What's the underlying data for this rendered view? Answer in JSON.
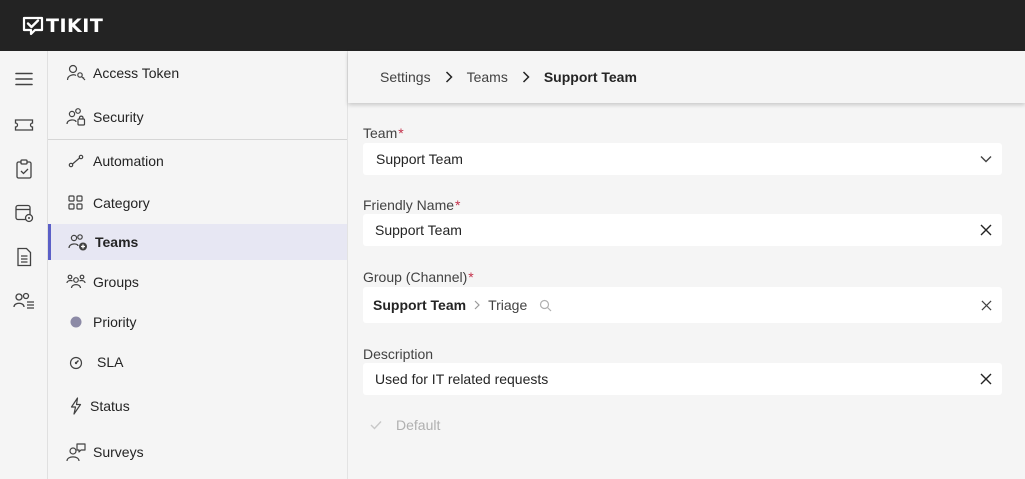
{
  "app": {
    "logo_text": "TIKIT"
  },
  "rail": {
    "items": [
      {
        "icon": "hamburger-menu-icon"
      },
      {
        "icon": "ticket-icon"
      },
      {
        "icon": "clipboard-icon"
      },
      {
        "icon": "calendar-settings-icon"
      },
      {
        "icon": "document-icon"
      },
      {
        "icon": "people-list-icon"
      }
    ]
  },
  "sidebar": {
    "items": [
      {
        "label": "Access Token",
        "icon": "person-key-icon"
      },
      {
        "label": "Security",
        "icon": "people-lock-icon"
      },
      {
        "label": "Automation",
        "icon": "flow-icon"
      },
      {
        "label": "Category",
        "icon": "grid-icon"
      },
      {
        "label": "Teams",
        "icon": "people-add-icon",
        "active": true
      },
      {
        "label": "Groups",
        "icon": "people-community-icon"
      },
      {
        "label": "Priority",
        "icon": "circle-icon"
      },
      {
        "label": "SLA",
        "icon": "gauge-icon"
      },
      {
        "label": "Status",
        "icon": "flash-icon"
      },
      {
        "label": "Surveys",
        "icon": "person-feedback-icon"
      }
    ]
  },
  "breadcrumb": {
    "items": [
      "Settings",
      "Teams",
      "Support Team"
    ]
  },
  "form": {
    "team": {
      "label": "Team",
      "required": "*",
      "value": "Support Team"
    },
    "friendly_name": {
      "label": "Friendly Name",
      "required": "*",
      "value": "Support Team"
    },
    "group": {
      "label": "Group (Channel)",
      "required": "*",
      "team": "Support Team",
      "channel": "Triage"
    },
    "description": {
      "label": "Description",
      "value": "Used for IT related requests"
    },
    "default": {
      "label": "Default",
      "checked": true,
      "disabled": true
    }
  },
  "colors": {
    "topbar": "#232323",
    "accent": "#5b5fc7",
    "required": "#c4314b",
    "active_bg": "#e7e7f3"
  }
}
